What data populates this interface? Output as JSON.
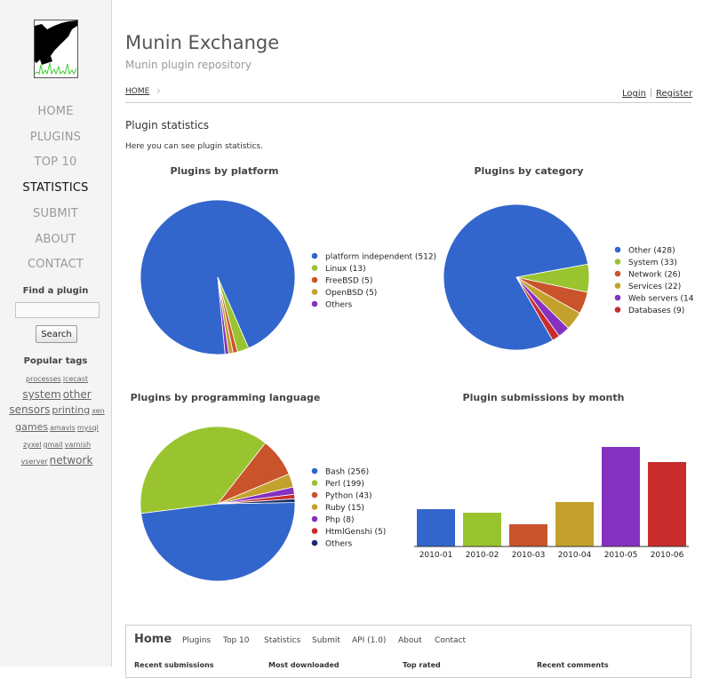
{
  "site": {
    "title": "Munin Exchange",
    "subtitle": "Munin plugin repository"
  },
  "nav": {
    "items": [
      "HOME",
      "PLUGINS",
      "TOP 10",
      "STATISTICS",
      "SUBMIT",
      "ABOUT",
      "CONTACT"
    ],
    "active": "STATISTICS"
  },
  "search": {
    "label": "Find a plugin",
    "button": "Search",
    "value": ""
  },
  "tags": {
    "label": "Popular tags",
    "items": [
      "processes",
      "icecast",
      "system",
      "other",
      "sensors",
      "printing",
      "xen",
      "games",
      "amavis",
      "mysql",
      "zyxel",
      "gmail",
      "varnish",
      "vserver",
      "network"
    ]
  },
  "breadcrumb": {
    "home": "HOME"
  },
  "auth": {
    "login": "Login",
    "separator": "|",
    "register": "Register"
  },
  "page": {
    "heading": "Plugin statistics",
    "intro": "Here you can see plugin statistics."
  },
  "chart_data": [
    {
      "type": "pie",
      "title": "Plugins by platform",
      "legend_position": "right",
      "labels": [
        "platform independent (512)",
        "Linux (13)",
        "FreeBSD (5)",
        "OpenBSD (5)",
        "Others"
      ],
      "values": [
        512,
        13,
        5,
        5,
        4
      ],
      "colors": [
        "#3366cc",
        "#99c42f",
        "#c9542c",
        "#c3a12c",
        "#8431c0"
      ]
    },
    {
      "type": "pie",
      "title": "Plugins by category",
      "legend_position": "right",
      "labels": [
        "Other (428)",
        "System (33)",
        "Network (26)",
        "Services (22)",
        "Web servers (14",
        "Databases (9)"
      ],
      "values": [
        428,
        33,
        26,
        22,
        14,
        9
      ],
      "colors": [
        "#3366cc",
        "#99c42f",
        "#c9542c",
        "#c3a12c",
        "#8431c0",
        "#c82c2c"
      ]
    },
    {
      "type": "pie",
      "title": "Plugins by programming language",
      "legend_position": "right",
      "labels": [
        "Bash (256)",
        "Perl (199)",
        "Python (43)",
        "Ruby (15)",
        "Php (8)",
        "HtmlGenshi (5)",
        "Others"
      ],
      "values": [
        256,
        199,
        43,
        15,
        8,
        5,
        4
      ],
      "colors": [
        "#3366cc",
        "#99c42f",
        "#c9542c",
        "#c3a12c",
        "#8431c0",
        "#c82c2c",
        "#1b2e6b"
      ]
    },
    {
      "type": "bar",
      "title": "Plugin submissions by month",
      "categories": [
        "2010-01",
        "2010-02",
        "2010-03",
        "2010-04",
        "2010-05",
        "2010-06"
      ],
      "values": [
        42,
        38,
        25,
        50,
        112,
        95
      ],
      "ylim": [
        0,
        112
      ],
      "colors": [
        "#3366cc",
        "#99c42f",
        "#c9542c",
        "#c3a12c",
        "#8431c0",
        "#c82c2c"
      ]
    }
  ],
  "footer": {
    "home": "Home",
    "links": [
      "Plugins",
      "Top 10",
      "Statistics",
      "Submit",
      "API (1.0)",
      "About",
      "Contact"
    ],
    "columns": [
      "Recent submissions",
      "Most downloaded",
      "Top rated",
      "Recent comments"
    ]
  }
}
